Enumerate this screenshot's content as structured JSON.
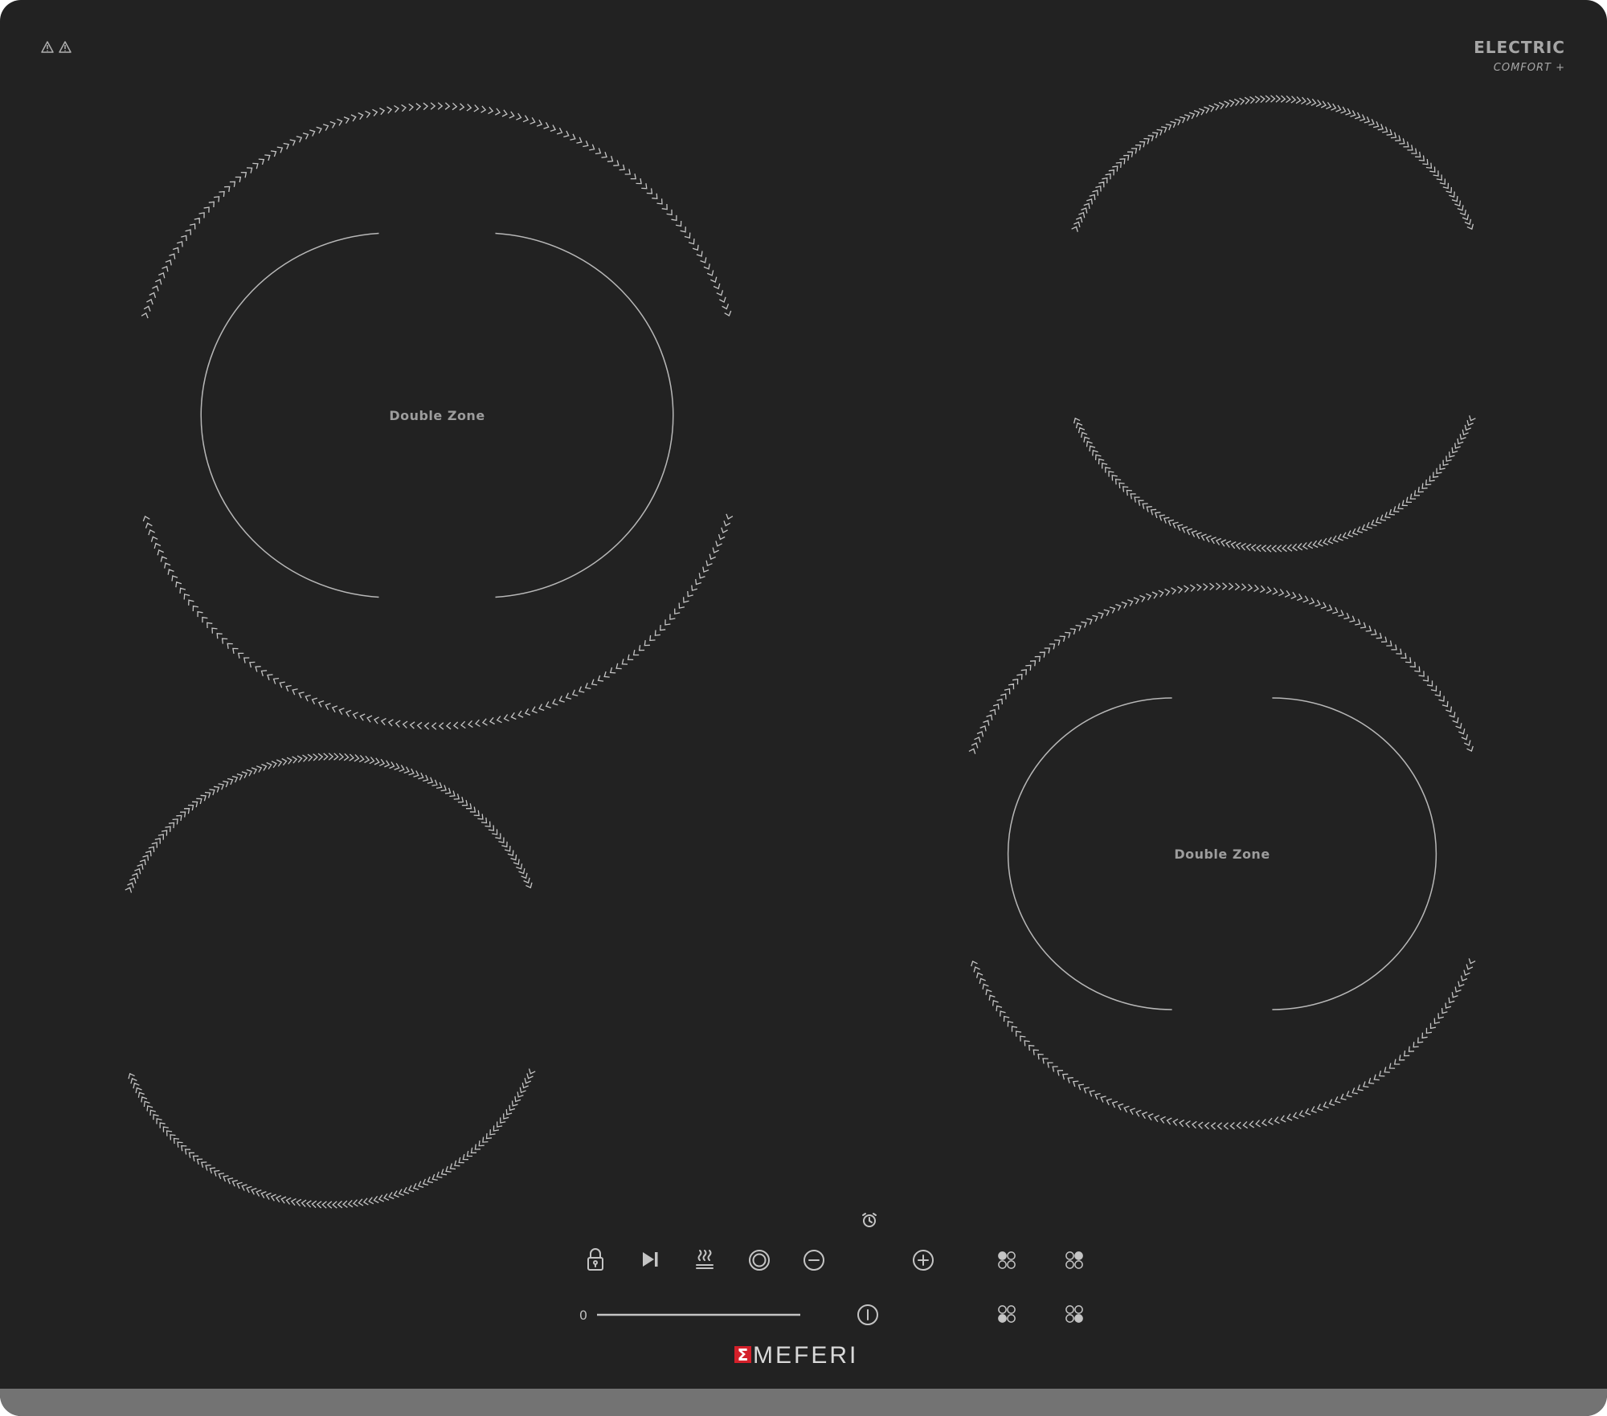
{
  "brand": {
    "series": "ELECTRIC",
    "sub": "COMFORT +",
    "logo": "MEFERI"
  },
  "zones": {
    "front_left_label": "Double Zone",
    "back_right_label": "Double Zone"
  },
  "controls": {
    "slider_min_label": "0",
    "icons": [
      "lock-icon",
      "skip-icon",
      "heat-icon",
      "zone-circle-icon",
      "minus-icon",
      "timer-icon",
      "plus-icon",
      "power-icon",
      "zone-select-icon"
    ]
  },
  "colors": {
    "glass": "#222222",
    "markings": "#c4c4c4",
    "logo_accent": "#d4202a"
  }
}
